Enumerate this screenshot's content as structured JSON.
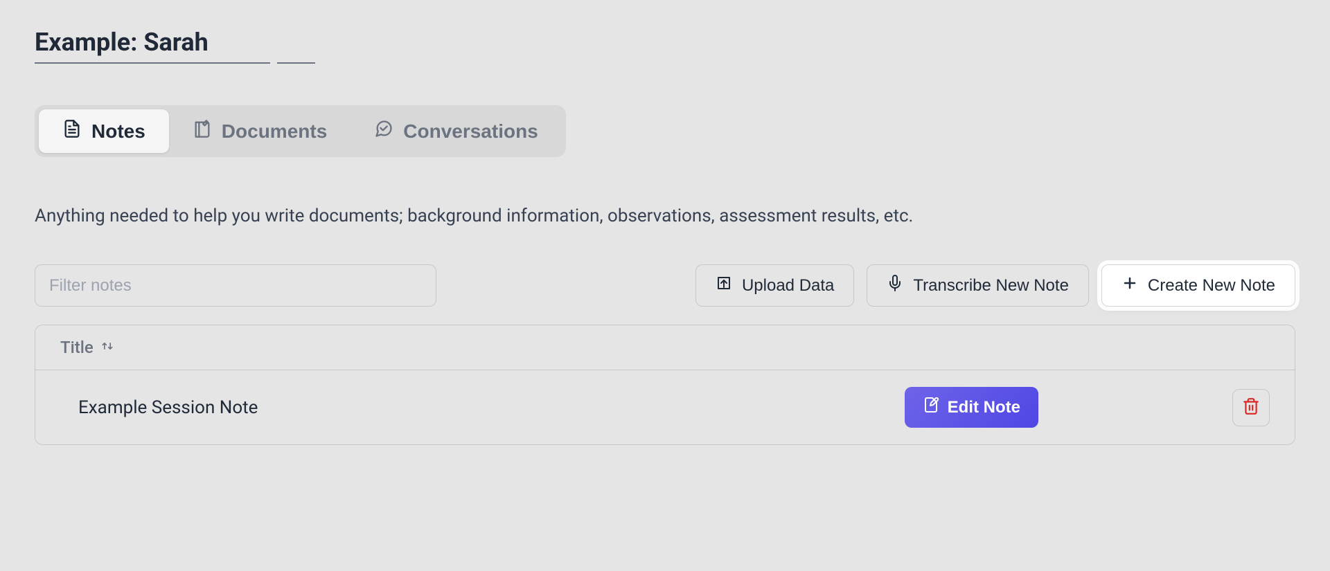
{
  "header": {
    "title": "Example: Sarah"
  },
  "tabs": [
    {
      "label": "Notes",
      "active": true
    },
    {
      "label": "Documents",
      "active": false
    },
    {
      "label": "Conversations",
      "active": false
    }
  ],
  "content": {
    "description": "Anything needed to help you write documents; background information, observations, assessment results, etc.",
    "filter": {
      "placeholder": "Filter notes"
    },
    "actions": {
      "upload": "Upload Data",
      "transcribe": "Transcribe New Note",
      "create": "Create New Note"
    },
    "table": {
      "columns": {
        "title": "Title"
      },
      "rows": [
        {
          "title": "Example Session Note",
          "edit_label": "Edit Note"
        }
      ]
    }
  }
}
